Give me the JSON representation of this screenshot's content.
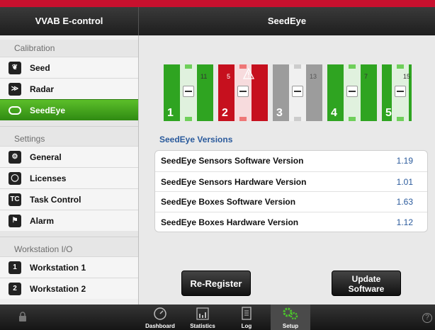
{
  "app_title": "VVAB E-control",
  "page_title": "SeedEye",
  "sidebar": {
    "sections": [
      {
        "title": "Calibration",
        "items": [
          {
            "label": "Seed",
            "icon": "seed-icon"
          },
          {
            "label": "Radar",
            "icon": "radar-icon"
          },
          {
            "label": "SeedEye",
            "icon": "seedeye-icon",
            "active": true
          }
        ]
      },
      {
        "title": "Settings",
        "items": [
          {
            "label": "General",
            "icon": "general-icon"
          },
          {
            "label": "Licenses",
            "icon": "licenses-icon"
          },
          {
            "label": "Task Control",
            "icon": "task-control-icon",
            "icon_text": "TC"
          },
          {
            "label": "Alarm",
            "icon": "alarm-icon"
          }
        ]
      },
      {
        "title": "Workstation I/O",
        "items": [
          {
            "label": "Workstation 1",
            "icon": "workstation-1-icon",
            "icon_text": "1"
          },
          {
            "label": "Workstation 2",
            "icon": "workstation-2-icon",
            "icon_text": "2"
          }
        ]
      }
    ]
  },
  "rows": [
    {
      "number": "1",
      "sensor": "11",
      "status": "ok",
      "color": "#2fa421"
    },
    {
      "number": "2",
      "sensor": "5",
      "status": "warning",
      "color": "#c6101e"
    },
    {
      "number": "3",
      "sensor": "13",
      "status": "inactive",
      "color": "#9c9c9c"
    },
    {
      "number": "4",
      "sensor": "7",
      "status": "ok",
      "color": "#2fa421"
    },
    {
      "number": "5",
      "sensor": "15",
      "status": "ok",
      "color": "#2fa421"
    }
  ],
  "versions": {
    "title": "SeedEye Versions",
    "items": [
      {
        "label": "SeedEye Sensors Software Version",
        "value": "1.19"
      },
      {
        "label": "SeedEye Sensors Hardware Version",
        "value": "1.01"
      },
      {
        "label": "SeedEye Boxes Software Version",
        "value": "1.63"
      },
      {
        "label": "SeedEye Boxes Hardware Version",
        "value": "1.12"
      }
    ]
  },
  "buttons": {
    "reregister": "Re-Register",
    "update_line1": "Update",
    "update_line2": "Software"
  },
  "tabbar": {
    "tabs": [
      {
        "label": "Dashboard",
        "icon": "dashboard-icon"
      },
      {
        "label": "Statistics",
        "icon": "statistics-icon"
      },
      {
        "label": "Log",
        "icon": "log-icon"
      },
      {
        "label": "Setup",
        "icon": "setup-icon",
        "active": true
      }
    ],
    "help": "?"
  },
  "colors": {
    "accent_red": "#c8102e",
    "active_green": "#3fa81f",
    "link_blue": "#2a5a9c"
  }
}
